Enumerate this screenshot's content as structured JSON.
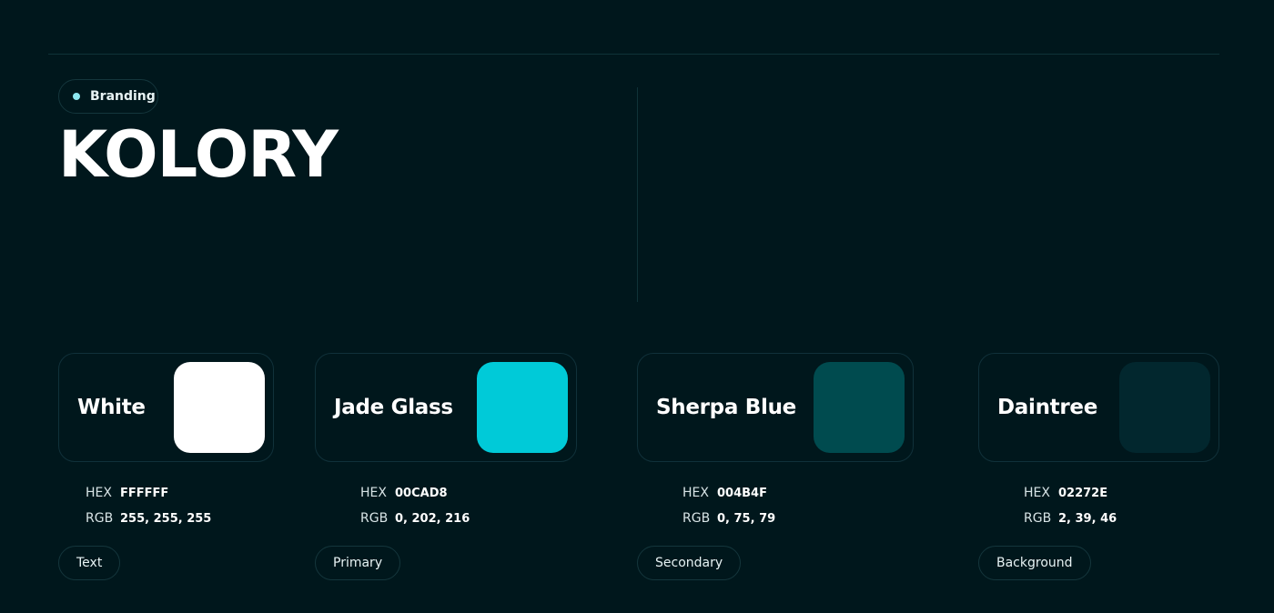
{
  "header": {
    "badge_label": "Branding",
    "title": "KOLORY"
  },
  "labels": {
    "hex": "HEX",
    "rgb": "RGB"
  },
  "swatches": [
    {
      "name": "White",
      "hex": "FFFFFF",
      "rgb": "255, 255, 255",
      "role": "Text",
      "color": "#FFFFFF"
    },
    {
      "name": "Jade Glass",
      "hex": "00CAD8",
      "rgb": "0, 202, 216",
      "role": "Primary",
      "color": "#00CAD8"
    },
    {
      "name": "Sherpa Blue",
      "hex": "004B4F",
      "rgb": "0, 75, 79",
      "role": "Secondary",
      "color": "#004B4F"
    },
    {
      "name": "Daintree",
      "hex": "02272E",
      "rgb": "2, 39, 46",
      "role": "Background",
      "color": "#02272E"
    }
  ],
  "theme": {
    "page_background": "#00171C",
    "badge_dot": "#8DE8F0"
  }
}
